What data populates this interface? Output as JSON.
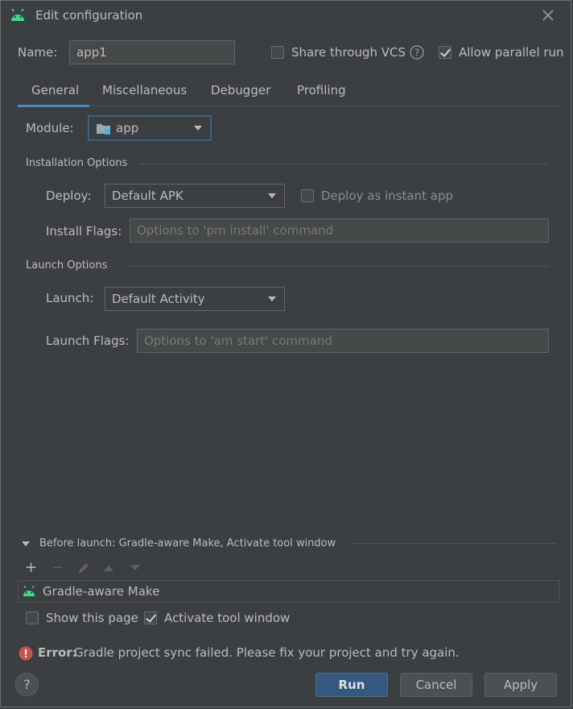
{
  "window": {
    "title": "Edit configuration"
  },
  "name": {
    "label": "Name:",
    "value": "app1"
  },
  "share_vcs": {
    "label": "Share through VCS",
    "checked": false
  },
  "allow_parallel": {
    "label": "Allow parallel run",
    "checked": true
  },
  "tabs": [
    {
      "label": "General",
      "active": true
    },
    {
      "label": "Miscellaneous",
      "active": false
    },
    {
      "label": "Debugger",
      "active": false
    },
    {
      "label": "Profiling",
      "active": false
    }
  ],
  "module": {
    "label": "Module:",
    "value": "app"
  },
  "installation": {
    "section_title": "Installation Options",
    "deploy_label": "Deploy:",
    "deploy_value": "Default APK",
    "instant_label": "Deploy as instant app",
    "instant_checked": false,
    "flags_label": "Install Flags:",
    "flags_placeholder": "Options to 'pm install' command"
  },
  "launch": {
    "section_title": "Launch Options",
    "launch_label": "Launch:",
    "launch_value": "Default Activity",
    "flags_label": "Launch Flags:",
    "flags_placeholder": "Options to 'am start' command"
  },
  "before_launch": {
    "title": "Before launch: Gradle-aware Make, Activate tool window",
    "items": [
      "Gradle-aware Make"
    ]
  },
  "show_page": {
    "label": "Show this page",
    "checked": false
  },
  "activate_tool": {
    "label": "Activate tool window",
    "checked": true
  },
  "error": {
    "prefix": "Error:",
    "message": "Gradle project sync failed. Please fix your project and try again."
  },
  "buttons": {
    "help": "?",
    "run": "Run",
    "cancel": "Cancel",
    "apply": "Apply"
  },
  "colors": {
    "accent": "#4a88c7",
    "android_green": "#3ddc84",
    "error_red": "#c75450",
    "primary_button": "#365880"
  }
}
